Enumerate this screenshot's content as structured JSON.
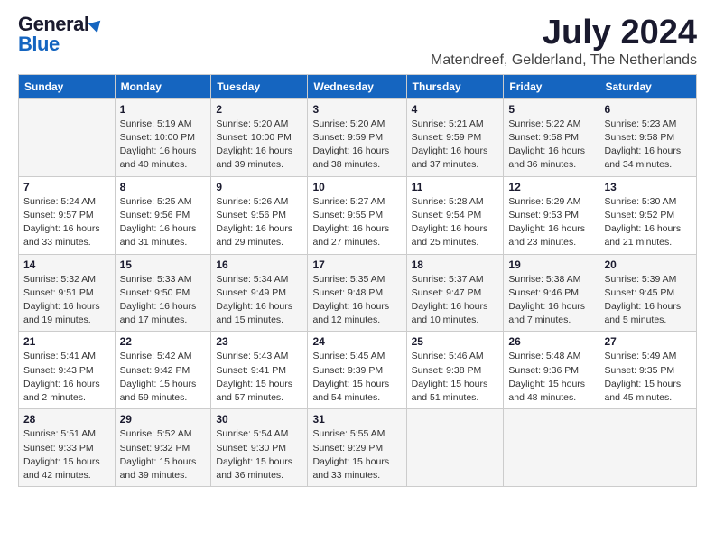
{
  "logo": {
    "general": "General",
    "blue": "Blue"
  },
  "title": "July 2024",
  "location": "Matendreef, Gelderland, The Netherlands",
  "days_of_week": [
    "Sunday",
    "Monday",
    "Tuesday",
    "Wednesday",
    "Thursday",
    "Friday",
    "Saturday"
  ],
  "weeks": [
    [
      {
        "day": "",
        "info": ""
      },
      {
        "day": "1",
        "info": "Sunrise: 5:19 AM\nSunset: 10:00 PM\nDaylight: 16 hours\nand 40 minutes."
      },
      {
        "day": "2",
        "info": "Sunrise: 5:20 AM\nSunset: 10:00 PM\nDaylight: 16 hours\nand 39 minutes."
      },
      {
        "day": "3",
        "info": "Sunrise: 5:20 AM\nSunset: 9:59 PM\nDaylight: 16 hours\nand 38 minutes."
      },
      {
        "day": "4",
        "info": "Sunrise: 5:21 AM\nSunset: 9:59 PM\nDaylight: 16 hours\nand 37 minutes."
      },
      {
        "day": "5",
        "info": "Sunrise: 5:22 AM\nSunset: 9:58 PM\nDaylight: 16 hours\nand 36 minutes."
      },
      {
        "day": "6",
        "info": "Sunrise: 5:23 AM\nSunset: 9:58 PM\nDaylight: 16 hours\nand 34 minutes."
      }
    ],
    [
      {
        "day": "7",
        "info": "Sunrise: 5:24 AM\nSunset: 9:57 PM\nDaylight: 16 hours\nand 33 minutes."
      },
      {
        "day": "8",
        "info": "Sunrise: 5:25 AM\nSunset: 9:56 PM\nDaylight: 16 hours\nand 31 minutes."
      },
      {
        "day": "9",
        "info": "Sunrise: 5:26 AM\nSunset: 9:56 PM\nDaylight: 16 hours\nand 29 minutes."
      },
      {
        "day": "10",
        "info": "Sunrise: 5:27 AM\nSunset: 9:55 PM\nDaylight: 16 hours\nand 27 minutes."
      },
      {
        "day": "11",
        "info": "Sunrise: 5:28 AM\nSunset: 9:54 PM\nDaylight: 16 hours\nand 25 minutes."
      },
      {
        "day": "12",
        "info": "Sunrise: 5:29 AM\nSunset: 9:53 PM\nDaylight: 16 hours\nand 23 minutes."
      },
      {
        "day": "13",
        "info": "Sunrise: 5:30 AM\nSunset: 9:52 PM\nDaylight: 16 hours\nand 21 minutes."
      }
    ],
    [
      {
        "day": "14",
        "info": "Sunrise: 5:32 AM\nSunset: 9:51 PM\nDaylight: 16 hours\nand 19 minutes."
      },
      {
        "day": "15",
        "info": "Sunrise: 5:33 AM\nSunset: 9:50 PM\nDaylight: 16 hours\nand 17 minutes."
      },
      {
        "day": "16",
        "info": "Sunrise: 5:34 AM\nSunset: 9:49 PM\nDaylight: 16 hours\nand 15 minutes."
      },
      {
        "day": "17",
        "info": "Sunrise: 5:35 AM\nSunset: 9:48 PM\nDaylight: 16 hours\nand 12 minutes."
      },
      {
        "day": "18",
        "info": "Sunrise: 5:37 AM\nSunset: 9:47 PM\nDaylight: 16 hours\nand 10 minutes."
      },
      {
        "day": "19",
        "info": "Sunrise: 5:38 AM\nSunset: 9:46 PM\nDaylight: 16 hours\nand 7 minutes."
      },
      {
        "day": "20",
        "info": "Sunrise: 5:39 AM\nSunset: 9:45 PM\nDaylight: 16 hours\nand 5 minutes."
      }
    ],
    [
      {
        "day": "21",
        "info": "Sunrise: 5:41 AM\nSunset: 9:43 PM\nDaylight: 16 hours\nand 2 minutes."
      },
      {
        "day": "22",
        "info": "Sunrise: 5:42 AM\nSunset: 9:42 PM\nDaylight: 15 hours\nand 59 minutes."
      },
      {
        "day": "23",
        "info": "Sunrise: 5:43 AM\nSunset: 9:41 PM\nDaylight: 15 hours\nand 57 minutes."
      },
      {
        "day": "24",
        "info": "Sunrise: 5:45 AM\nSunset: 9:39 PM\nDaylight: 15 hours\nand 54 minutes."
      },
      {
        "day": "25",
        "info": "Sunrise: 5:46 AM\nSunset: 9:38 PM\nDaylight: 15 hours\nand 51 minutes."
      },
      {
        "day": "26",
        "info": "Sunrise: 5:48 AM\nSunset: 9:36 PM\nDaylight: 15 hours\nand 48 minutes."
      },
      {
        "day": "27",
        "info": "Sunrise: 5:49 AM\nSunset: 9:35 PM\nDaylight: 15 hours\nand 45 minutes."
      }
    ],
    [
      {
        "day": "28",
        "info": "Sunrise: 5:51 AM\nSunset: 9:33 PM\nDaylight: 15 hours\nand 42 minutes."
      },
      {
        "day": "29",
        "info": "Sunrise: 5:52 AM\nSunset: 9:32 PM\nDaylight: 15 hours\nand 39 minutes."
      },
      {
        "day": "30",
        "info": "Sunrise: 5:54 AM\nSunset: 9:30 PM\nDaylight: 15 hours\nand 36 minutes."
      },
      {
        "day": "31",
        "info": "Sunrise: 5:55 AM\nSunset: 9:29 PM\nDaylight: 15 hours\nand 33 minutes."
      },
      {
        "day": "",
        "info": ""
      },
      {
        "day": "",
        "info": ""
      },
      {
        "day": "",
        "info": ""
      }
    ]
  ]
}
